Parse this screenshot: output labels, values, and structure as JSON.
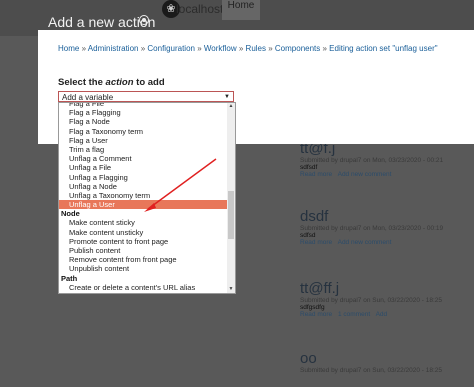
{
  "header": {
    "site_name": "localhost",
    "home_tab": "Home",
    "dialog_title": "Add a new action"
  },
  "breadcrumb": [
    "Home",
    "Administration",
    "Configuration",
    "Workflow",
    "Rules",
    "Components",
    "Editing action set \"unflag user\""
  ],
  "select": {
    "label_prefix": "Select the ",
    "label_em": "action",
    "label_suffix": " to add",
    "value": "Add a variable"
  },
  "dropdown": {
    "items": [
      {
        "type": "item",
        "label": "Flag a File"
      },
      {
        "type": "item",
        "label": "Flag a Flagging"
      },
      {
        "type": "item",
        "label": "Flag a Node"
      },
      {
        "type": "item",
        "label": "Flag a Taxonomy term"
      },
      {
        "type": "item",
        "label": "Flag a User"
      },
      {
        "type": "item",
        "label": "Trim a flag"
      },
      {
        "type": "item",
        "label": "Unflag a Comment"
      },
      {
        "type": "item",
        "label": "Unflag a File"
      },
      {
        "type": "item",
        "label": "Unflag a Flagging"
      },
      {
        "type": "item",
        "label": "Unflag a Node"
      },
      {
        "type": "item",
        "label": "Unflag a Taxonomy term"
      },
      {
        "type": "item",
        "label": "Unflag a User",
        "selected": true
      },
      {
        "type": "group",
        "label": "Node"
      },
      {
        "type": "item",
        "label": "Make content sticky"
      },
      {
        "type": "item",
        "label": "Make content unsticky"
      },
      {
        "type": "item",
        "label": "Promote content to front page"
      },
      {
        "type": "item",
        "label": "Publish content"
      },
      {
        "type": "item",
        "label": "Remove content from front page"
      },
      {
        "type": "item",
        "label": "Unpublish content"
      },
      {
        "type": "group",
        "label": "Path"
      },
      {
        "type": "item",
        "label": "Create or delete a content's URL alias"
      }
    ]
  },
  "nodes": [
    {
      "title": "tt@f.j",
      "meta": "Submitted by drupal7 on Mon, 03/23/2020 - 00:21",
      "body": "sdfsdf",
      "links": [
        "Read more",
        "Add new comment"
      ]
    },
    {
      "title": "dsdf",
      "meta": "Submitted by drupal7 on Mon, 03/23/2020 - 00:19",
      "body": "sdfsd",
      "links": [
        "Read more",
        "Add new comment"
      ]
    },
    {
      "title": "tt@ff.j",
      "meta": "Submitted by drupal7 on Sun, 03/22/2020 - 18:25",
      "body": "sdfgsdfg",
      "links": [
        "Read more",
        "1 comment",
        "Add"
      ]
    },
    {
      "title": "oo",
      "meta": "Submitted by drupal7 on Sun, 03/22/2020 - 18:25",
      "body": "",
      "links": []
    }
  ]
}
